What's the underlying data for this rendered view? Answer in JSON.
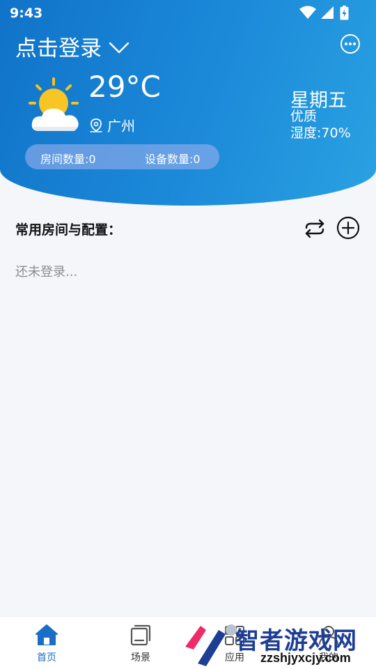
{
  "status_bar": {
    "time": "9:43"
  },
  "header": {
    "login_label": "点击登录",
    "temperature": "29°C",
    "city": "广州",
    "weekday": "星期五",
    "air_quality": "优质",
    "humidity": "湿度:70%",
    "room_count": "房间数量:0",
    "device_count": "设备数量:0"
  },
  "section": {
    "title": "常用房间与配置：",
    "empty_text": "还未登录..."
  },
  "bottom_nav": {
    "items": [
      {
        "label": "首页",
        "icon": "home-icon",
        "active": true
      },
      {
        "label": "场景",
        "icon": "scene-icon",
        "active": false
      },
      {
        "label": "应用",
        "icon": "apps-icon",
        "active": false
      },
      {
        "label": "我的",
        "icon": "profile-icon",
        "active": false
      }
    ]
  },
  "watermark": {
    "title": "智者游戏网",
    "site": "zzshjyxcjy.com"
  },
  "colors": {
    "header_blue": "#1073c9",
    "header_light": "#2aa2e2",
    "active_nav": "#1a6fc4",
    "background": "#f4f6f9"
  }
}
